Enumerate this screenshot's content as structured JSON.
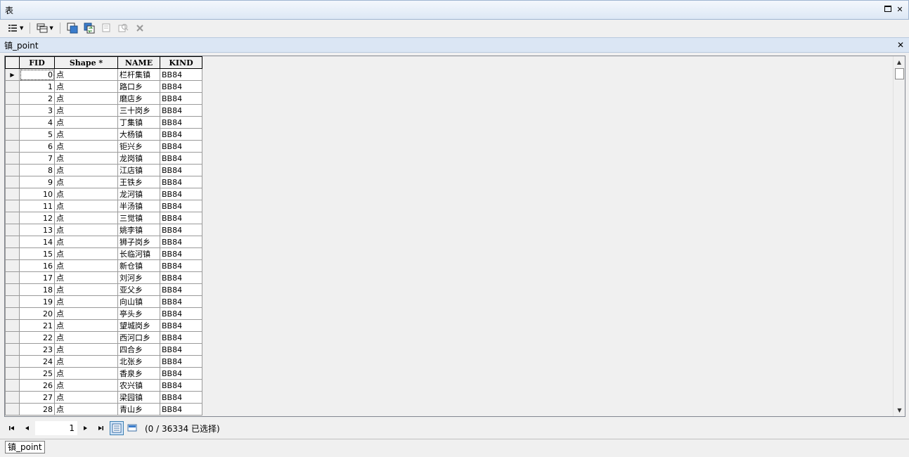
{
  "window": {
    "title": "表"
  },
  "toolbar": {
    "icons": [
      "table-options-icon",
      "related-tables-icon",
      "select-by-attributes-icon",
      "switch-selection-icon",
      "clear-selection-icon",
      "zoom-to-selected-icon",
      "delete-selected-icon"
    ]
  },
  "table_tab": {
    "title": "镇_point"
  },
  "grid": {
    "columns": [
      "FID",
      "Shape *",
      "NAME",
      "KIND"
    ],
    "rows": [
      [
        "0",
        "点",
        "栏杆集镇",
        "BB84"
      ],
      [
        "1",
        "点",
        "路口乡",
        "BB84"
      ],
      [
        "2",
        "点",
        "磨店乡",
        "BB84"
      ],
      [
        "3",
        "点",
        "三十岗乡",
        "BB84"
      ],
      [
        "4",
        "点",
        "丁集镇",
        "BB84"
      ],
      [
        "5",
        "点",
        "大杨镇",
        "BB84"
      ],
      [
        "6",
        "点",
        "钜兴乡",
        "BB84"
      ],
      [
        "7",
        "点",
        "龙岗镇",
        "BB84"
      ],
      [
        "8",
        "点",
        "江店镇",
        "BB84"
      ],
      [
        "9",
        "点",
        "王铁乡",
        "BB84"
      ],
      [
        "10",
        "点",
        "龙河镇",
        "BB84"
      ],
      [
        "11",
        "点",
        "半汤镇",
        "BB84"
      ],
      [
        "12",
        "点",
        "三觉镇",
        "BB84"
      ],
      [
        "13",
        "点",
        "姚李镇",
        "BB84"
      ],
      [
        "14",
        "点",
        "狮子岗乡",
        "BB84"
      ],
      [
        "15",
        "点",
        "长临河镇",
        "BB84"
      ],
      [
        "16",
        "点",
        "新仓镇",
        "BB84"
      ],
      [
        "17",
        "点",
        "刘河乡",
        "BB84"
      ],
      [
        "18",
        "点",
        "亚父乡",
        "BB84"
      ],
      [
        "19",
        "点",
        "向山镇",
        "BB84"
      ],
      [
        "20",
        "点",
        "亭头乡",
        "BB84"
      ],
      [
        "21",
        "点",
        "望城岗乡",
        "BB84"
      ],
      [
        "22",
        "点",
        "西河口乡",
        "BB84"
      ],
      [
        "23",
        "点",
        "四合乡",
        "BB84"
      ],
      [
        "24",
        "点",
        "北张乡",
        "BB84"
      ],
      [
        "25",
        "点",
        "香泉乡",
        "BB84"
      ],
      [
        "26",
        "点",
        "农兴镇",
        "BB84"
      ],
      [
        "27",
        "点",
        "梁园镇",
        "BB84"
      ],
      [
        "28",
        "点",
        "青山乡",
        "BB84"
      ]
    ]
  },
  "navigation": {
    "current_record": "1",
    "status": "(0 / 36334 已选择)"
  },
  "bottom_tabs": [
    {
      "label": "镇_point"
    }
  ]
}
